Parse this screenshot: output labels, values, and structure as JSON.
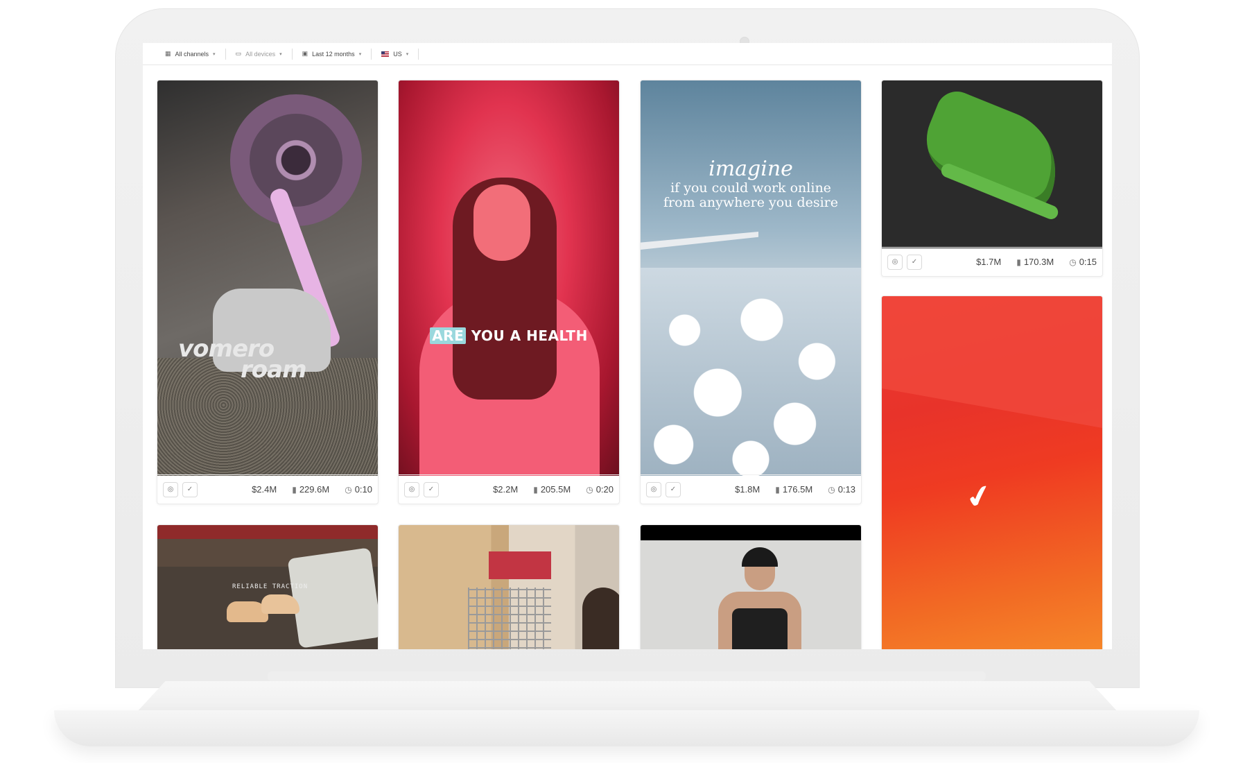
{
  "filters": [
    {
      "icon": "grid-icon",
      "label": "All channels",
      "muted": false
    },
    {
      "icon": "devices-icon",
      "label": "All devices",
      "muted": true
    },
    {
      "icon": "calendar-icon",
      "label": "Last 12 months",
      "muted": false
    },
    {
      "icon": "us-flag-icon",
      "label": "US",
      "muted": false
    }
  ],
  "cards": [
    {
      "id": "vomero",
      "overlay_text": [
        "vomero",
        "roam"
      ],
      "spend": "$2.4M",
      "views": "229.6M",
      "duration": "0:10"
    },
    {
      "id": "health",
      "caption_highlight": "ARE",
      "caption_rest": " YOU A HEALTH",
      "spend": "$2.2M",
      "views": "205.5M",
      "duration": "0:20"
    },
    {
      "id": "sky",
      "overlay_big": "imagine",
      "overlay_line1": "if you could work online",
      "overlay_line2": "from anywhere you desire",
      "spend": "$1.8M",
      "views": "176.5M",
      "duration": "0:13"
    },
    {
      "id": "shoe",
      "spend": "$1.7M",
      "views": "170.3M",
      "duration": "0:15"
    },
    {
      "id": "nike-swoosh"
    },
    {
      "id": "kitchen",
      "overlay_text": "RELIABLE TRACTION"
    },
    {
      "id": "shelf"
    },
    {
      "id": "dance"
    }
  ],
  "icons": {
    "settings": "target-icon",
    "brand": "swoosh-icon",
    "views": "bar-chart-icon",
    "duration": "play-clock-icon"
  }
}
